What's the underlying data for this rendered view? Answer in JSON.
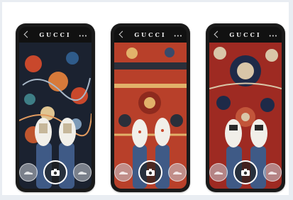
{
  "phones": [
    {
      "brand": "GUCCI",
      "carpet_base": "#1b2230",
      "carpet_accent": "#c9482c"
    },
    {
      "brand": "GUCCI",
      "carpet_base": "#b8402a",
      "carpet_accent": "#e2b26a"
    },
    {
      "brand": "GUCCI",
      "carpet_base": "#9e2a22",
      "carpet_accent": "#d9c6a8"
    }
  ],
  "colors": {
    "background": "#e9edf2",
    "phone_body": "#1a1a1a",
    "jeans": "#3f5a86",
    "shoe": "#f1efe9"
  },
  "icons": [
    "back-arrow-icon",
    "menu-dots-icon",
    "camera-icon",
    "sneaker-thumbnail-icon"
  ]
}
